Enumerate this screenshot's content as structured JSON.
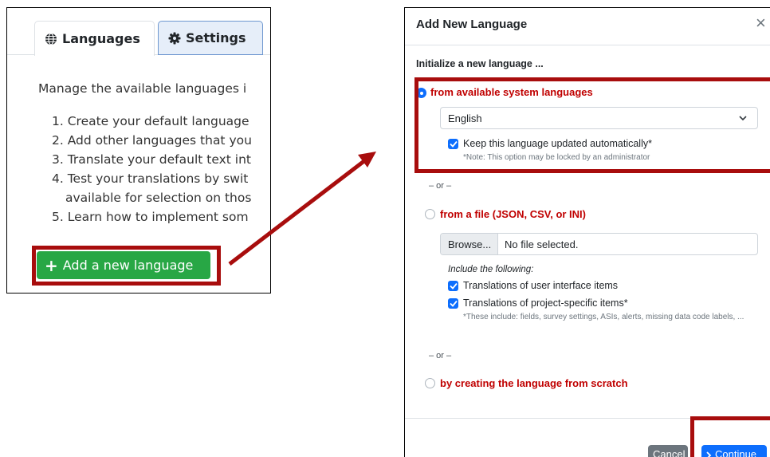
{
  "left_panel": {
    "tabs": [
      {
        "label": "Languages",
        "icon": "globe-icon",
        "active": true
      },
      {
        "label": "Settings",
        "icon": "gear-icon",
        "active": false
      }
    ],
    "intro": "Manage the available languages i",
    "steps": [
      "1. Create your default language",
      "2. Add other languages that you",
      "3. Translate your default text int",
      "4. Test your translations by swit",
      "available for selection on thos",
      "5. Learn how to implement som"
    ],
    "add_button_label": "Add a new language"
  },
  "dialog": {
    "title": "Add New Language",
    "close_icon": "close-icon",
    "init_label": "Initialize a new language ...",
    "option_system": {
      "label": "from available system languages",
      "selected": true,
      "select_value": "English",
      "auto_update_label": "Keep this language updated automatically*",
      "auto_update_checked": true,
      "note": "*Note: This option may be locked by an administrator"
    },
    "or_text": "– or –",
    "option_file": {
      "label": "from a file (JSON, CSV, or INI)",
      "selected": false,
      "browse_label": "Browse...",
      "file_name": "No file selected.",
      "include_label": "Include the following:",
      "include_ui_label": "Translations of user interface items",
      "include_project_label": "Translations of project-specific items*",
      "note": "*These include: fields, survey settings, ASIs, alerts, missing data code labels, ..."
    },
    "option_scratch": {
      "label": "by creating the language from scratch",
      "selected": false
    },
    "cancel_label": "Cancel",
    "continue_label": "Continue"
  },
  "colors": {
    "highlight": "#a80d0d",
    "success": "#28a745",
    "primary": "#0d6efd",
    "secondary": "#6c757d",
    "option_label": "#c00000"
  }
}
